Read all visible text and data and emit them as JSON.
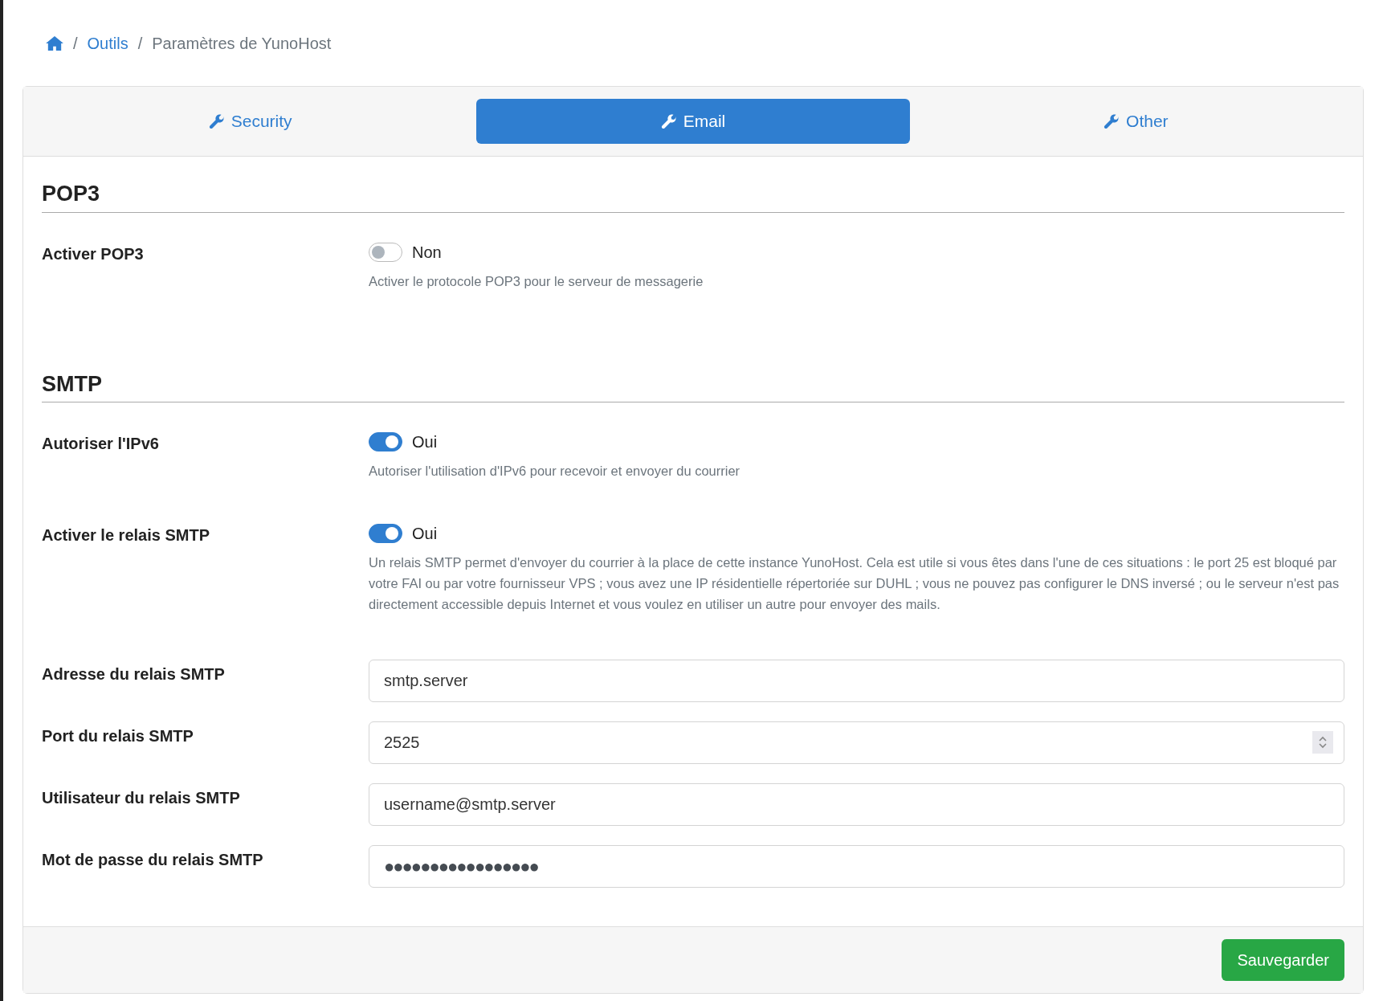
{
  "breadcrumb": {
    "items": [
      {
        "label": "Outils",
        "separator": "/"
      }
    ],
    "current_separator": "/",
    "current": "Paramètres de YunoHost"
  },
  "tabs": [
    {
      "label": "Security",
      "selected": false
    },
    {
      "label": "Email",
      "selected": true
    },
    {
      "label": "Other",
      "selected": false
    }
  ],
  "sections": [
    {
      "title": "POP3",
      "rows": [
        {
          "kind": "toggle",
          "label": "Activer POP3",
          "on": false,
          "state_text": "Non",
          "help": "Activer le protocole POP3 pour le serveur de messagerie"
        }
      ]
    },
    {
      "title": "SMTP",
      "rows": [
        {
          "kind": "toggle",
          "label": "Autoriser l'IPv6",
          "on": true,
          "state_text": "Oui",
          "help": "Autoriser l'utilisation d'IPv6 pour recevoir et envoyer du courrier"
        },
        {
          "kind": "toggle",
          "label": "Activer le relais SMTP",
          "on": true,
          "state_text": "Oui",
          "help": "Un relais SMTP permet d'envoyer du courrier à la place de cette instance YunoHost. Cela est utile si vous êtes dans l'une de ces situations : le port 25 est bloqué par votre FAI ou par votre fournisseur VPS ; vous avez une IP résidentielle répertoriée sur DUHL ; vous ne pouvez pas configurer le DNS inversé ; ou le serveur n'est pas directement accessible depuis Internet et vous voulez en utiliser un autre pour envoyer des mails."
        },
        {
          "kind": "text",
          "label": "Adresse du relais SMTP",
          "value": "smtp.server"
        },
        {
          "kind": "number",
          "label": "Port du relais SMTP",
          "value": "2525"
        },
        {
          "kind": "text",
          "label": "Utilisateur du relais SMTP",
          "value": "username@smtp.server"
        },
        {
          "kind": "password",
          "label": "Mot de passe du relais SMTP",
          "value": "●●●●●●●●●●●●●●●●●"
        }
      ]
    }
  ],
  "save_button": "Sauvegarder"
}
